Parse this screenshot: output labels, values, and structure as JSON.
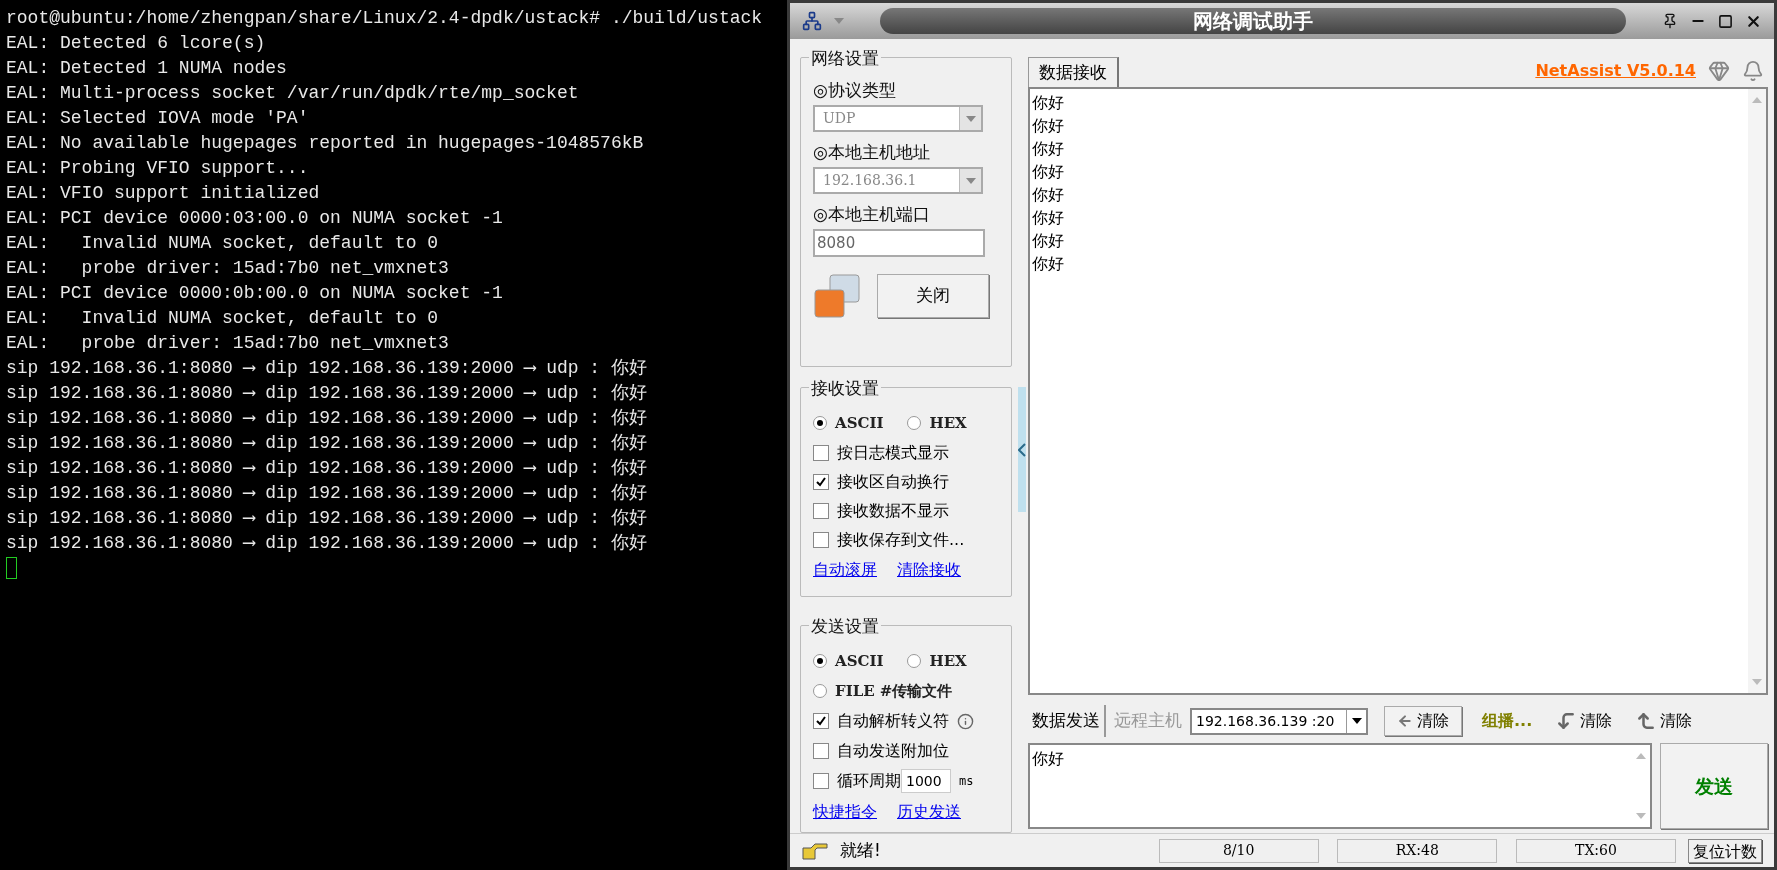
{
  "terminal": {
    "lines": [
      "root@ubuntu:/home/zhengpan/share/Linux/2.4-dpdk/ustack# ./build/ustack",
      "EAL: Detected 6 lcore(s)",
      "EAL: Detected 1 NUMA nodes",
      "EAL: Multi-process socket /var/run/dpdk/rte/mp_socket",
      "EAL: Selected IOVA mode 'PA'",
      "EAL: No available hugepages reported in hugepages-1048576kB",
      "EAL: Probing VFIO support...",
      "EAL: VFIO support initialized",
      "EAL: PCI device 0000:03:00.0 on NUMA socket -1",
      "EAL:   Invalid NUMA socket, default to 0",
      "EAL:   probe driver: 15ad:7b0 net_vmxnet3",
      "EAL: PCI device 0000:0b:00.0 on NUMA socket -1",
      "EAL:   Invalid NUMA socket, default to 0",
      "EAL:   probe driver: 15ad:7b0 net_vmxnet3",
      "sip 192.168.36.1:8080 ⟶ dip 192.168.36.139:2000 ⟶ udp : 你好",
      "sip 192.168.36.1:8080 ⟶ dip 192.168.36.139:2000 ⟶ udp : 你好",
      "sip 192.168.36.1:8080 ⟶ dip 192.168.36.139:2000 ⟶ udp : 你好",
      "sip 192.168.36.1:8080 ⟶ dip 192.168.36.139:2000 ⟶ udp : 你好",
      "sip 192.168.36.1:8080 ⟶ dip 192.168.36.139:2000 ⟶ udp : 你好",
      "sip 192.168.36.1:8080 ⟶ dip 192.168.36.139:2000 ⟶ udp : 你好",
      "sip 192.168.36.1:8080 ⟶ dip 192.168.36.139:2000 ⟶ udp : 你好",
      "sip 192.168.36.1:8080 ⟶ dip 192.168.36.139:2000 ⟶ udp : 你好"
    ]
  },
  "window": {
    "title": "网络调试助手"
  },
  "network_settings": {
    "title": "网络设置",
    "fields": [
      {
        "label": "◎协议类型",
        "kind": "combo",
        "value": "UDP"
      },
      {
        "label": "◎本地主机地址",
        "kind": "combo",
        "value": "192.168.36.1"
      },
      {
        "label": "◎本地主机端口",
        "kind": "input",
        "value": "8080"
      }
    ],
    "button": "关闭"
  },
  "receive_settings": {
    "title": "接收设置",
    "modes": [
      {
        "label": "ASCII",
        "selected": true
      },
      {
        "label": "HEX",
        "selected": false
      }
    ],
    "options": [
      {
        "label": "按日志模式显示",
        "checked": false
      },
      {
        "label": "接收区自动换行",
        "checked": true
      },
      {
        "label": "接收数据不显示",
        "checked": false
      },
      {
        "label": "接收保存到文件...",
        "checked": false
      }
    ],
    "links": [
      "自动滚屏",
      "清除接收"
    ]
  },
  "send_settings": {
    "title": "发送设置",
    "modes": [
      {
        "label": "ASCII",
        "selected": true
      },
      {
        "label": "HEX",
        "selected": false
      },
      {
        "label": "FILE #传输文件",
        "selected": false
      }
    ],
    "options": [
      {
        "label": "自动解析转义符",
        "checked": true,
        "kind": "info"
      },
      {
        "label": "自动发送附加位",
        "checked": false,
        "kind": "plain"
      },
      {
        "label": "循环周期",
        "checked": false,
        "kind": "period",
        "value": "1000",
        "unit": "ms"
      }
    ],
    "links": [
      "快捷指令",
      "历史发送"
    ]
  },
  "receive": {
    "tab": "数据接收",
    "version_link": "NetAssist V5.0.14",
    "lines": [
      "你好",
      "你好",
      "你好",
      "你好",
      "你好",
      "你好",
      "你好",
      "你好"
    ]
  },
  "send": {
    "tab": "数据发送",
    "remote_label": "远程主机",
    "remote_host": "192.168.36.139 :20",
    "tools": [
      {
        "label": "清除",
        "kind": "button"
      },
      {
        "label": "组播...",
        "kind": "multicast"
      },
      {
        "label": "清除",
        "kind": "down"
      },
      {
        "label": "清除",
        "kind": "up"
      }
    ],
    "text": "你好",
    "send_button": "发送"
  },
  "status_bar": {
    "message": "就绪!",
    "fields": [
      "8/10",
      "RX:48",
      "TX:60"
    ],
    "reset_button": "复位计数"
  }
}
